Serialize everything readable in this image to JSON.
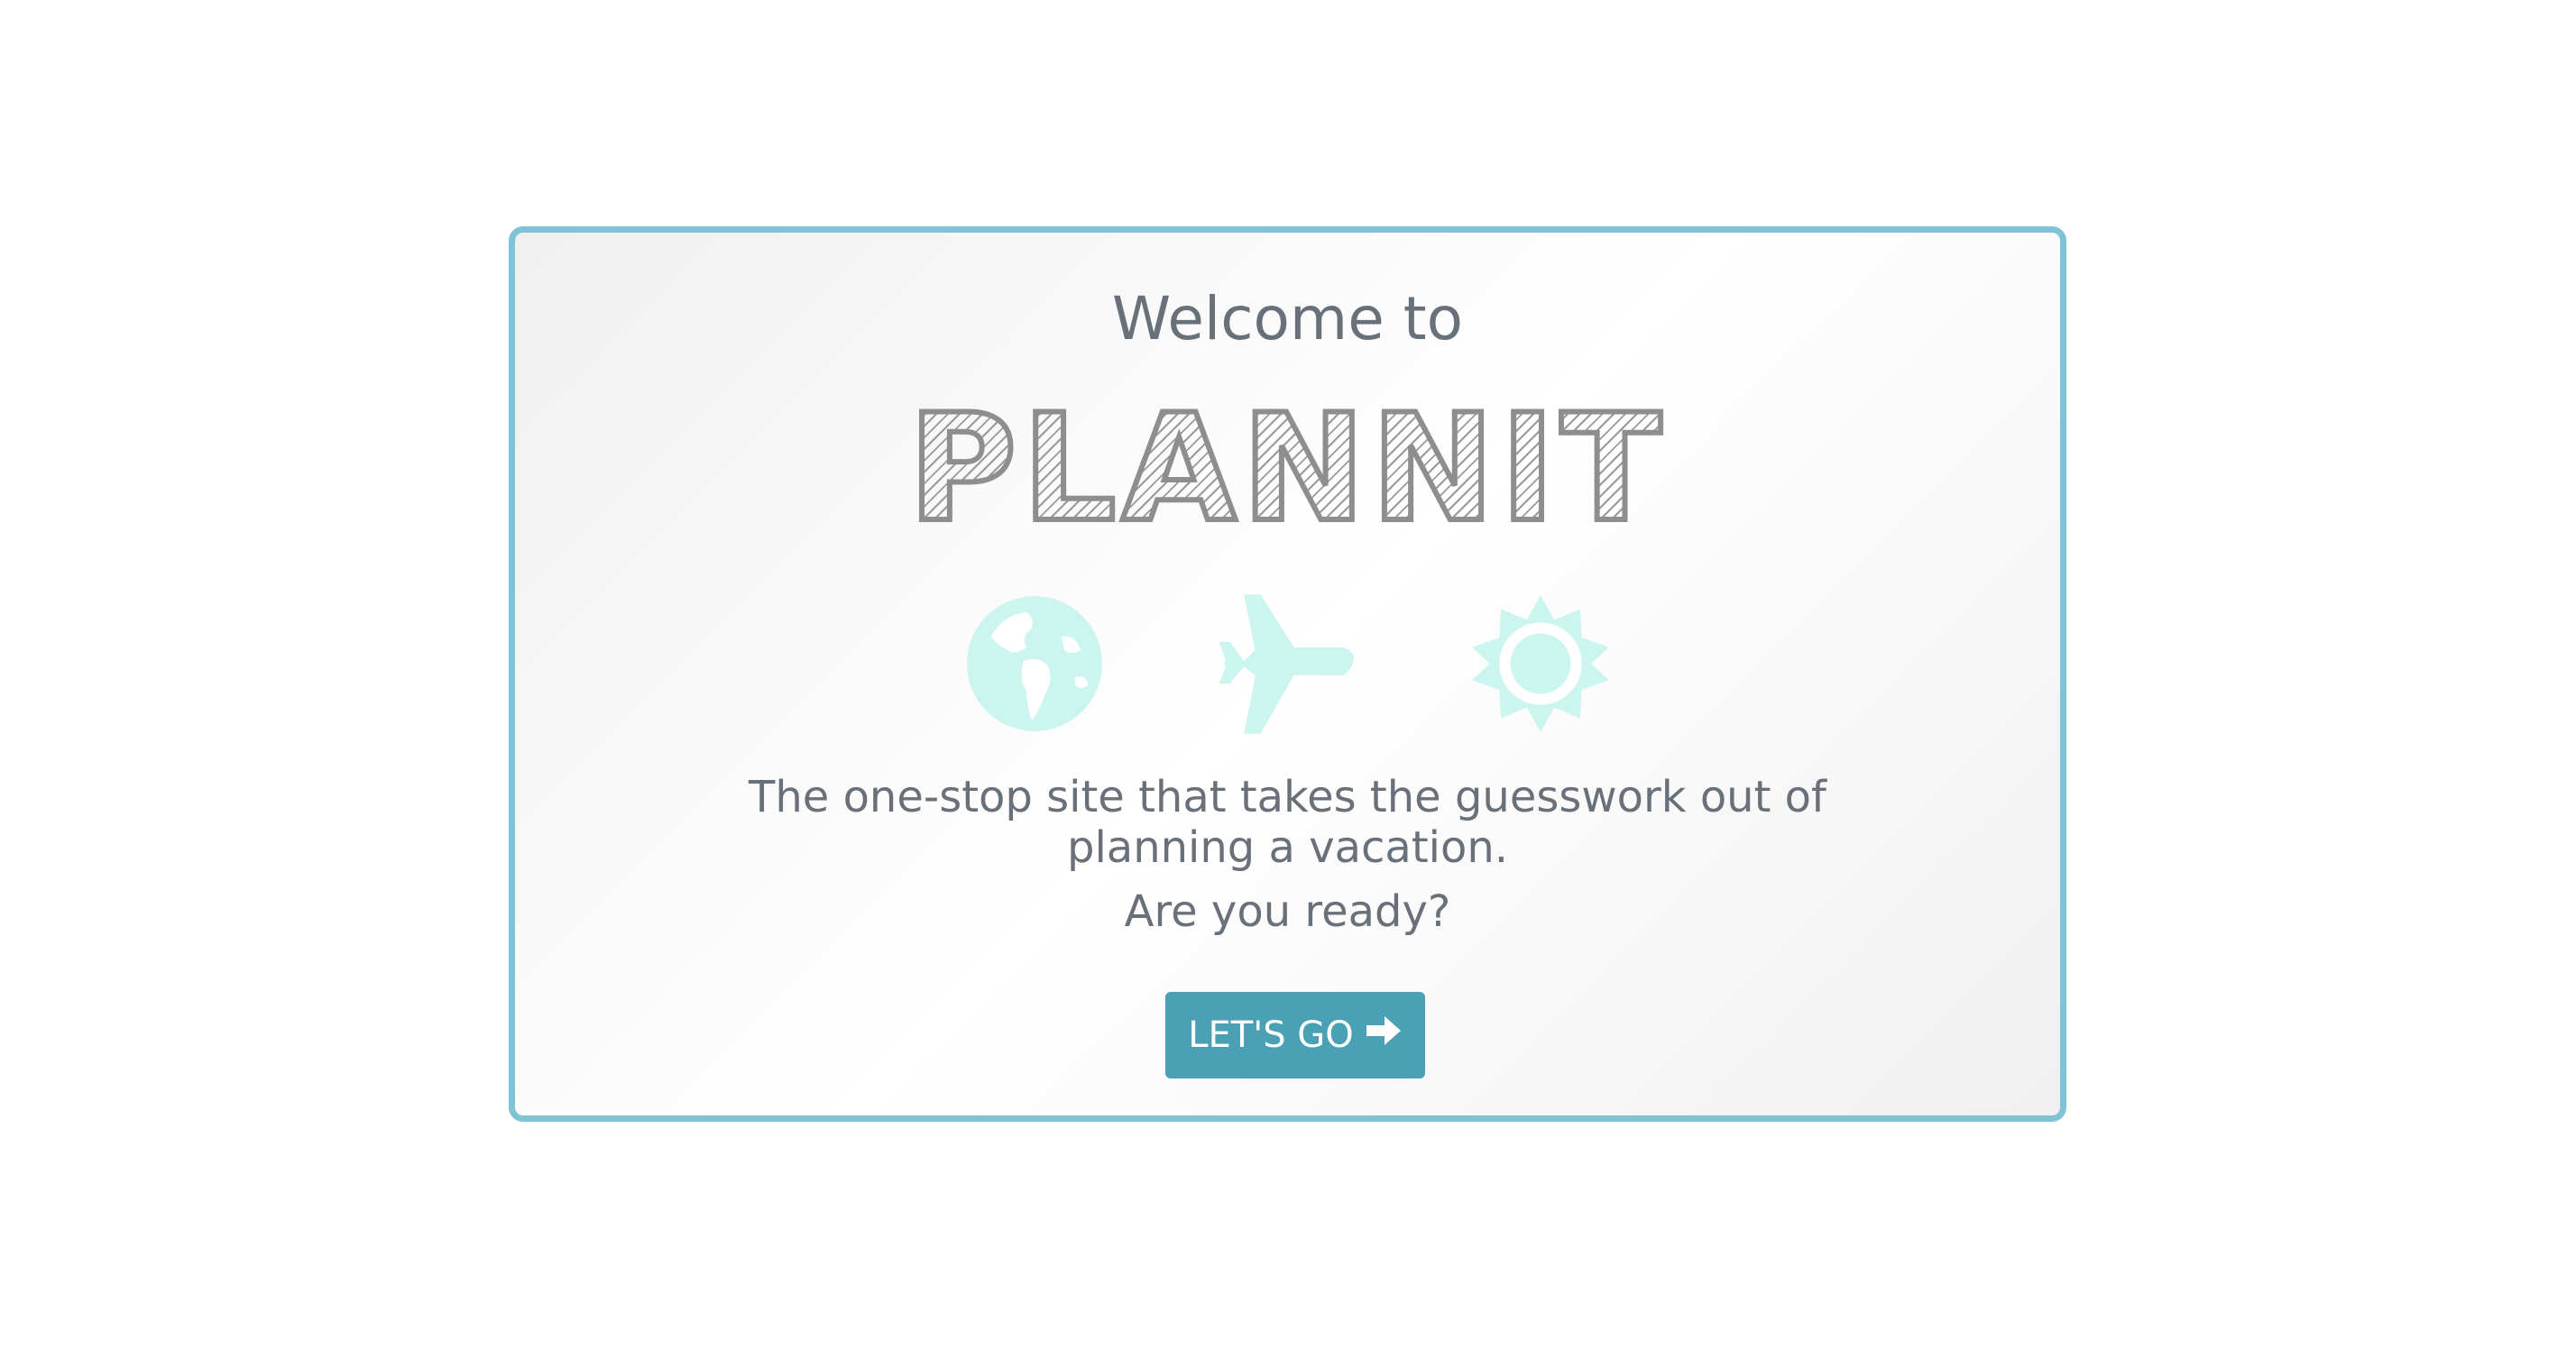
{
  "welcome": {
    "heading": "Welcome to",
    "logo_text": "PLANNIT",
    "icons": [
      "globe-icon",
      "airplane-icon",
      "sun-icon"
    ],
    "icon_color": "#cdf5f0",
    "tagline": "The one-stop site that takes the guesswork out of planning a vacation.",
    "question": "Are you ready?",
    "cta_label": "LET'S GO",
    "cta_icon": "arrow-right-icon"
  },
  "colors": {
    "border": "#7ec4d6",
    "button": "#4aa1b5",
    "text": "#68707a"
  }
}
